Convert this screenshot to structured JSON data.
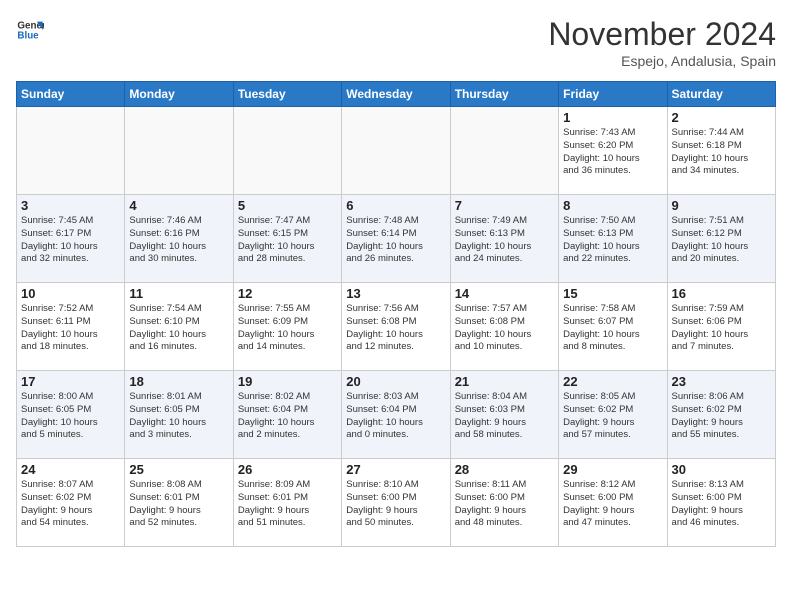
{
  "logo": {
    "line1": "General",
    "line2": "Blue"
  },
  "title": "November 2024",
  "subtitle": "Espejo, Andalusia, Spain",
  "days_of_week": [
    "Sunday",
    "Monday",
    "Tuesday",
    "Wednesday",
    "Thursday",
    "Friday",
    "Saturday"
  ],
  "weeks": [
    [
      {
        "day": "",
        "info": ""
      },
      {
        "day": "",
        "info": ""
      },
      {
        "day": "",
        "info": ""
      },
      {
        "day": "",
        "info": ""
      },
      {
        "day": "",
        "info": ""
      },
      {
        "day": "1",
        "info": "Sunrise: 7:43 AM\nSunset: 6:20 PM\nDaylight: 10 hours\nand 36 minutes."
      },
      {
        "day": "2",
        "info": "Sunrise: 7:44 AM\nSunset: 6:18 PM\nDaylight: 10 hours\nand 34 minutes."
      }
    ],
    [
      {
        "day": "3",
        "info": "Sunrise: 7:45 AM\nSunset: 6:17 PM\nDaylight: 10 hours\nand 32 minutes."
      },
      {
        "day": "4",
        "info": "Sunrise: 7:46 AM\nSunset: 6:16 PM\nDaylight: 10 hours\nand 30 minutes."
      },
      {
        "day": "5",
        "info": "Sunrise: 7:47 AM\nSunset: 6:15 PM\nDaylight: 10 hours\nand 28 minutes."
      },
      {
        "day": "6",
        "info": "Sunrise: 7:48 AM\nSunset: 6:14 PM\nDaylight: 10 hours\nand 26 minutes."
      },
      {
        "day": "7",
        "info": "Sunrise: 7:49 AM\nSunset: 6:13 PM\nDaylight: 10 hours\nand 24 minutes."
      },
      {
        "day": "8",
        "info": "Sunrise: 7:50 AM\nSunset: 6:13 PM\nDaylight: 10 hours\nand 22 minutes."
      },
      {
        "day": "9",
        "info": "Sunrise: 7:51 AM\nSunset: 6:12 PM\nDaylight: 10 hours\nand 20 minutes."
      }
    ],
    [
      {
        "day": "10",
        "info": "Sunrise: 7:52 AM\nSunset: 6:11 PM\nDaylight: 10 hours\nand 18 minutes."
      },
      {
        "day": "11",
        "info": "Sunrise: 7:54 AM\nSunset: 6:10 PM\nDaylight: 10 hours\nand 16 minutes."
      },
      {
        "day": "12",
        "info": "Sunrise: 7:55 AM\nSunset: 6:09 PM\nDaylight: 10 hours\nand 14 minutes."
      },
      {
        "day": "13",
        "info": "Sunrise: 7:56 AM\nSunset: 6:08 PM\nDaylight: 10 hours\nand 12 minutes."
      },
      {
        "day": "14",
        "info": "Sunrise: 7:57 AM\nSunset: 6:08 PM\nDaylight: 10 hours\nand 10 minutes."
      },
      {
        "day": "15",
        "info": "Sunrise: 7:58 AM\nSunset: 6:07 PM\nDaylight: 10 hours\nand 8 minutes."
      },
      {
        "day": "16",
        "info": "Sunrise: 7:59 AM\nSunset: 6:06 PM\nDaylight: 10 hours\nand 7 minutes."
      }
    ],
    [
      {
        "day": "17",
        "info": "Sunrise: 8:00 AM\nSunset: 6:05 PM\nDaylight: 10 hours\nand 5 minutes."
      },
      {
        "day": "18",
        "info": "Sunrise: 8:01 AM\nSunset: 6:05 PM\nDaylight: 10 hours\nand 3 minutes."
      },
      {
        "day": "19",
        "info": "Sunrise: 8:02 AM\nSunset: 6:04 PM\nDaylight: 10 hours\nand 2 minutes."
      },
      {
        "day": "20",
        "info": "Sunrise: 8:03 AM\nSunset: 6:04 PM\nDaylight: 10 hours\nand 0 minutes."
      },
      {
        "day": "21",
        "info": "Sunrise: 8:04 AM\nSunset: 6:03 PM\nDaylight: 9 hours\nand 58 minutes."
      },
      {
        "day": "22",
        "info": "Sunrise: 8:05 AM\nSunset: 6:02 PM\nDaylight: 9 hours\nand 57 minutes."
      },
      {
        "day": "23",
        "info": "Sunrise: 8:06 AM\nSunset: 6:02 PM\nDaylight: 9 hours\nand 55 minutes."
      }
    ],
    [
      {
        "day": "24",
        "info": "Sunrise: 8:07 AM\nSunset: 6:02 PM\nDaylight: 9 hours\nand 54 minutes."
      },
      {
        "day": "25",
        "info": "Sunrise: 8:08 AM\nSunset: 6:01 PM\nDaylight: 9 hours\nand 52 minutes."
      },
      {
        "day": "26",
        "info": "Sunrise: 8:09 AM\nSunset: 6:01 PM\nDaylight: 9 hours\nand 51 minutes."
      },
      {
        "day": "27",
        "info": "Sunrise: 8:10 AM\nSunset: 6:00 PM\nDaylight: 9 hours\nand 50 minutes."
      },
      {
        "day": "28",
        "info": "Sunrise: 8:11 AM\nSunset: 6:00 PM\nDaylight: 9 hours\nand 48 minutes."
      },
      {
        "day": "29",
        "info": "Sunrise: 8:12 AM\nSunset: 6:00 PM\nDaylight: 9 hours\nand 47 minutes."
      },
      {
        "day": "30",
        "info": "Sunrise: 8:13 AM\nSunset: 6:00 PM\nDaylight: 9 hours\nand 46 minutes."
      }
    ]
  ]
}
